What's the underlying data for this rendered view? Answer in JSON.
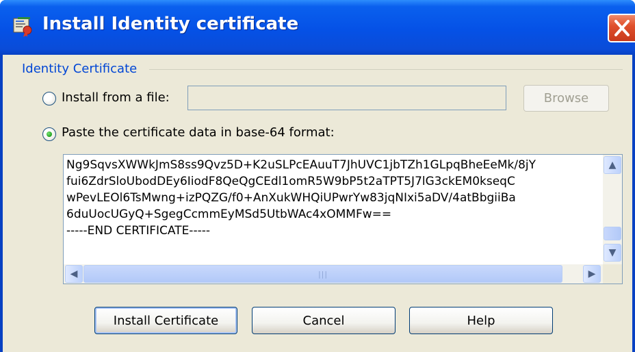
{
  "window": {
    "title": "Install Identity certificate",
    "accent_color": "#0a54e3",
    "close_color": "#e0512d"
  },
  "group": {
    "label": "Identity Certificate"
  },
  "options": {
    "from_file_label": "Install from a file:",
    "from_file_selected": false,
    "file_value": "",
    "browse_label": "Browse",
    "paste_label": "Paste the certificate data in base-64 format:",
    "paste_selected": true
  },
  "certificate": {
    "lines": [
      "Ng9SqvsXWWkJmS8ss9Qvz5D+K2uSLPcEAuuT7JhUVC1jbTZh1GLpqBheEeMk/8jY",
      "fui6ZdrSloUbodDEy6IiodF8QeQgCEdl1omR5W9bP5t2aTPT5J7lG3ckEM0kseqC",
      "wPevLEOl6TsMwng+izPQZG/f0+AnXukWHQiUPwrYw83jqNIxi5aDV/4atBbgiiBa",
      "6duUocUGyQ+SgegCcmmEyMSd5UtbWAc4xOMMFw==",
      "-----END CERTIFICATE-----"
    ]
  },
  "buttons": {
    "install": "Install Certificate",
    "cancel": "Cancel",
    "help": "Help"
  }
}
